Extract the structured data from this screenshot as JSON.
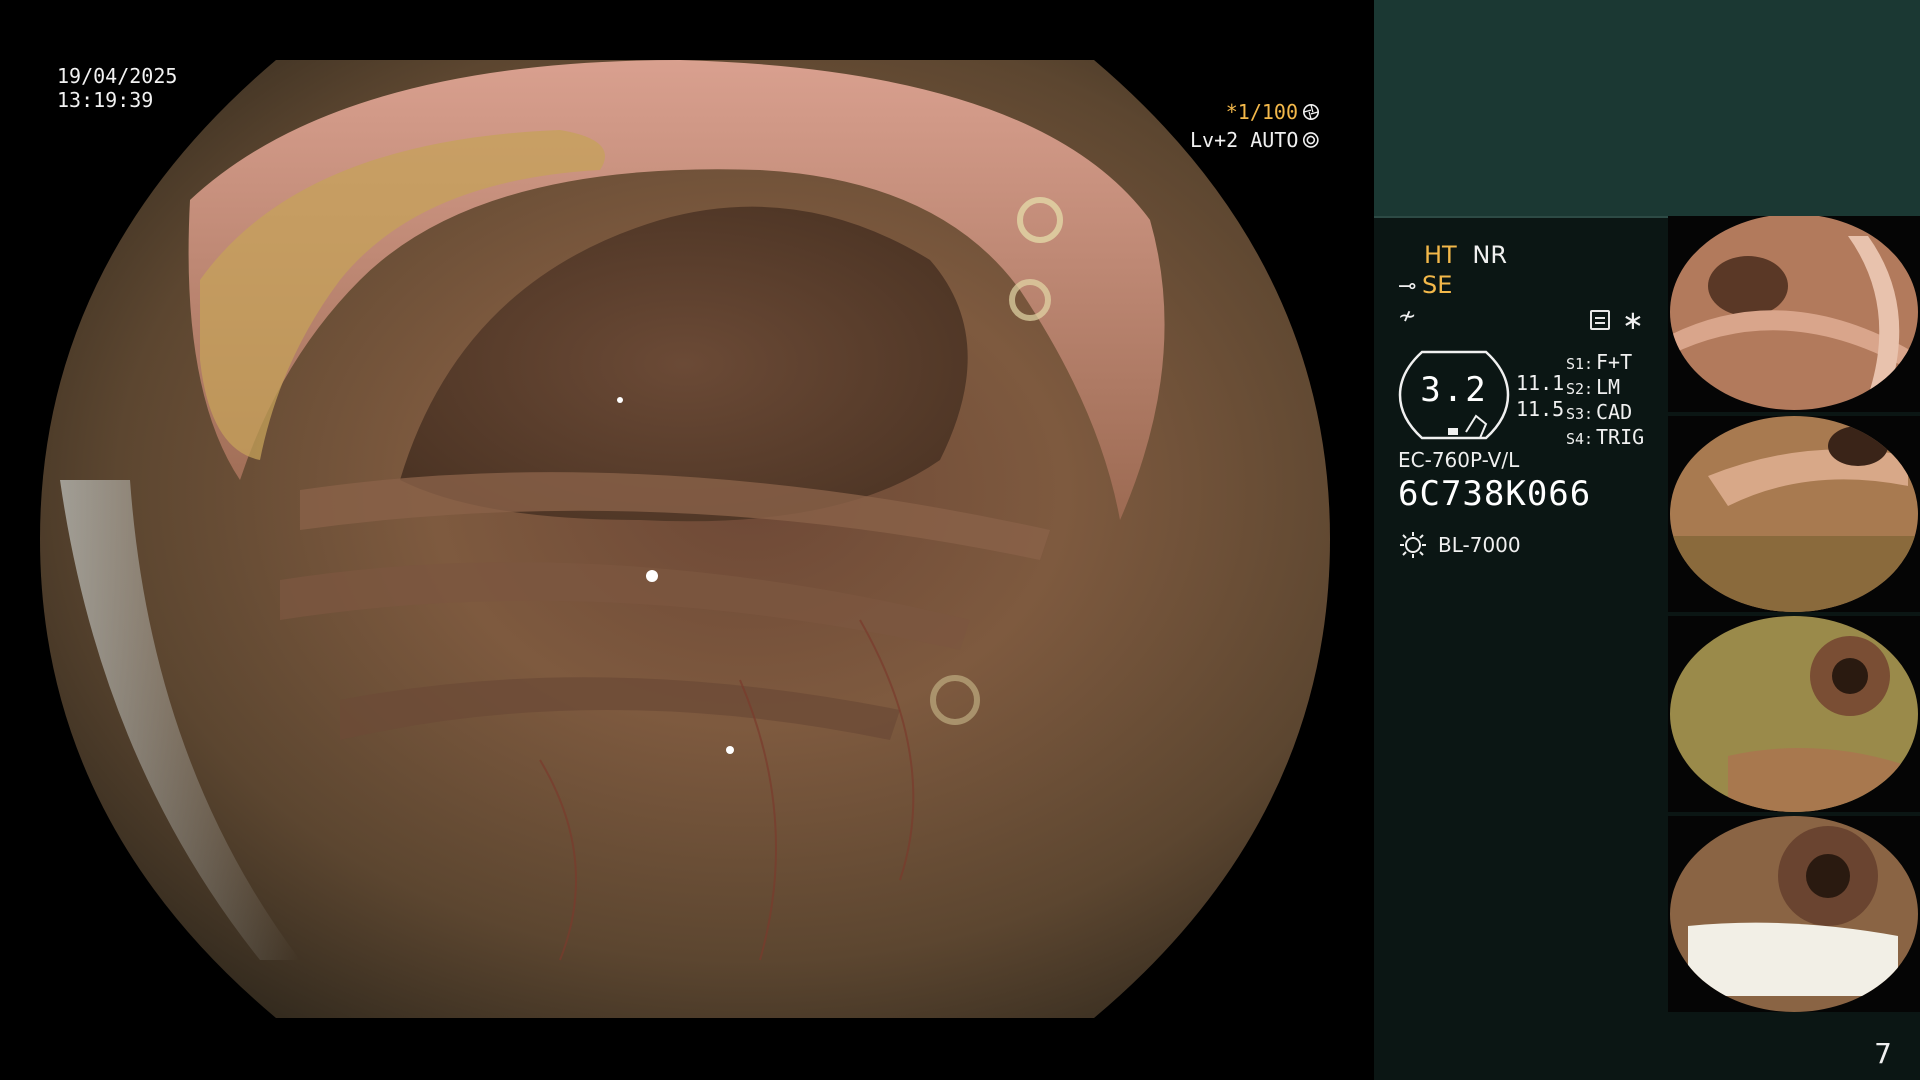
{
  "datetime": {
    "date": "19/04/2025",
    "time": "13:19:39"
  },
  "overlay": {
    "shutter": "*1/100",
    "level": "Lv+2 AUTO"
  },
  "panel": {
    "modes": {
      "ht": "HT",
      "nr": "NR",
      "se": "SE"
    },
    "gauge": {
      "value": "3.2",
      "readout_1": "11.1",
      "readout_2": "11.5"
    },
    "switches": [
      {
        "key": "S1:",
        "value": "F+T"
      },
      {
        "key": "S2:",
        "value": "LM"
      },
      {
        "key": "S3:",
        "value": "CAD"
      },
      {
        "key": "S4:",
        "value": "TRIG"
      }
    ],
    "scope_model": "EC-760P-V/L",
    "scope_serial": "6C738K066",
    "light_source": "BL-7000",
    "page_number": "7"
  },
  "colors": {
    "accent_orange": "#f3b84a",
    "panel_header": "#1b3833",
    "panel_bg": "#0b1614"
  },
  "icons": {
    "shutter": "aperture-icon",
    "level": "iris-icon",
    "scope": "scope-icon",
    "pulse": "waveform-icon",
    "pad": "pad-icon",
    "light": "sun-icon"
  }
}
